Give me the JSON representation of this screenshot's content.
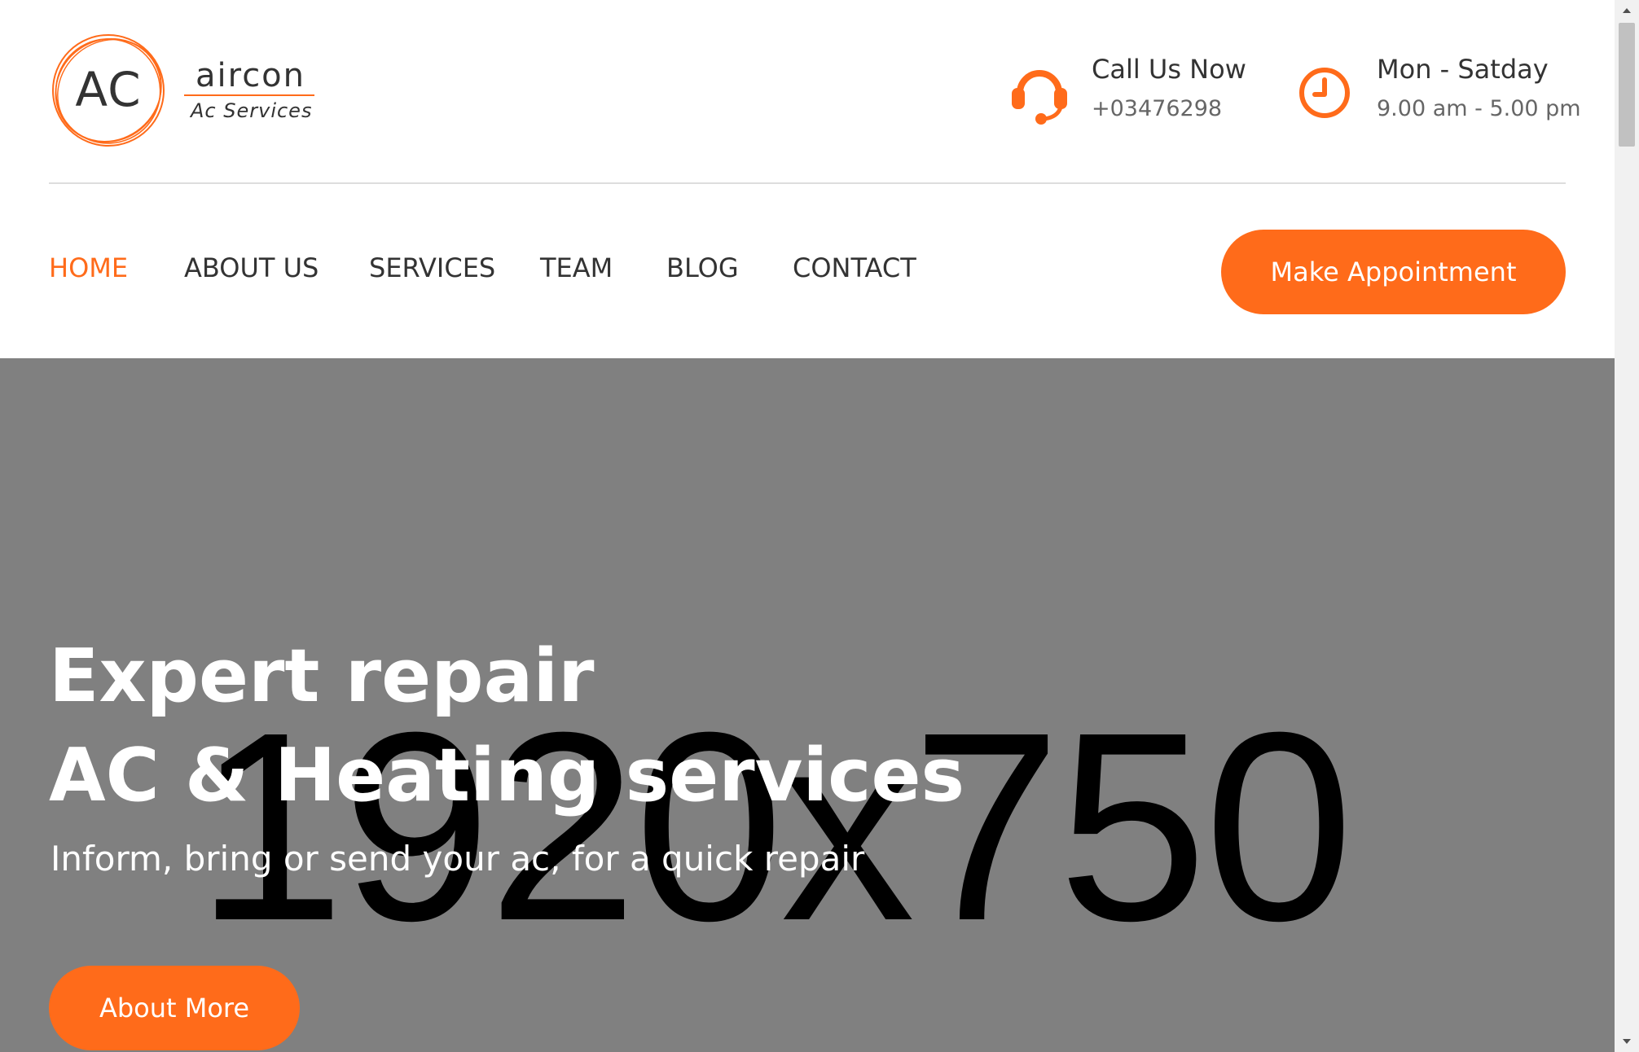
{
  "brand": {
    "mark": "AC",
    "name": "aircon",
    "tagline": "Ac Services",
    "accent_color": "#ff6b1a"
  },
  "contact_info": {
    "call": {
      "icon": "headset-icon",
      "title": "Call Us Now",
      "value": "+03476298"
    },
    "hours": {
      "icon": "clock-icon",
      "title": "Mon - Satday",
      "value": "9.00 am - 5.00 pm"
    }
  },
  "nav": {
    "items": [
      {
        "label": "HOME",
        "active": true
      },
      {
        "label": "ABOUT US",
        "active": false
      },
      {
        "label": "SERVICES",
        "active": false
      },
      {
        "label": "TEAM",
        "active": false
      },
      {
        "label": "BLOG",
        "active": false
      },
      {
        "label": "CONTACT",
        "active": false
      }
    ],
    "cta_label": "Make Appointment"
  },
  "hero": {
    "placeholder_text": "1920x750",
    "background_color": "#808080",
    "title_line1": "Expert repair",
    "title_line2": "AC & Heating services",
    "subtitle": "Inform, bring or send your ac, for a quick repair",
    "button_label": "About More"
  }
}
